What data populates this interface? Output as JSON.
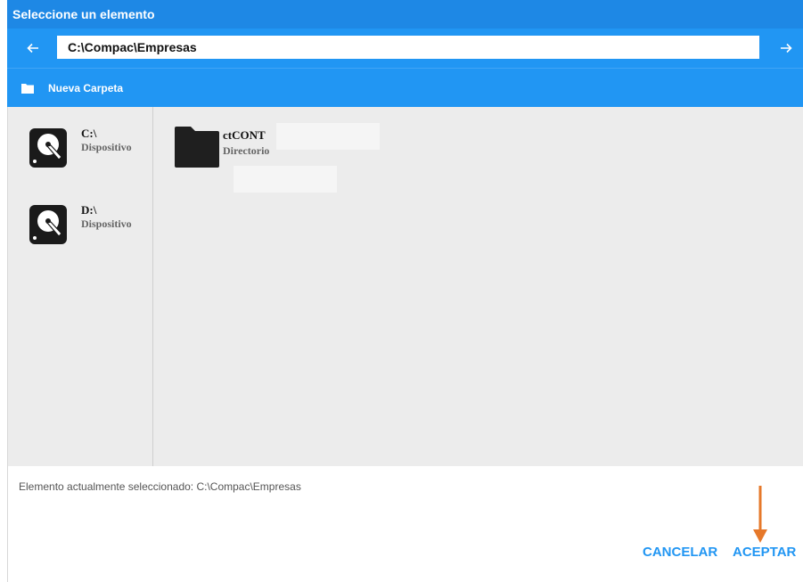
{
  "dialog": {
    "title": "Seleccione un elemento"
  },
  "pathbar": {
    "back_icon": "arrow-left-icon",
    "path_value": "C:\\Compac\\Empresas",
    "forward_icon": "arrow-right-icon"
  },
  "toolbar": {
    "new_folder_icon": "folder-icon",
    "new_folder_label": "Nueva Carpeta"
  },
  "devices": [
    {
      "icon": "hard-drive-icon",
      "name": "C:\\",
      "type": "Dispositivo"
    },
    {
      "icon": "hard-drive-icon",
      "name": "D:\\",
      "type": "Dispositivo"
    }
  ],
  "files": [
    {
      "icon": "folder-icon",
      "name": "ctCONT",
      "type": "Directorio"
    }
  ],
  "footer": {
    "selected_text": "Elemento actualmente seleccionado: C:\\Compac\\Empresas",
    "cancel_label": "CANCELAR",
    "accept_label": "ACEPTAR"
  },
  "colors": {
    "title_bar": "#1e88e5",
    "bar": "#2196f3",
    "panel": "#ececec",
    "button_text": "#2196f3",
    "annotation_arrow": "#e6782a"
  }
}
